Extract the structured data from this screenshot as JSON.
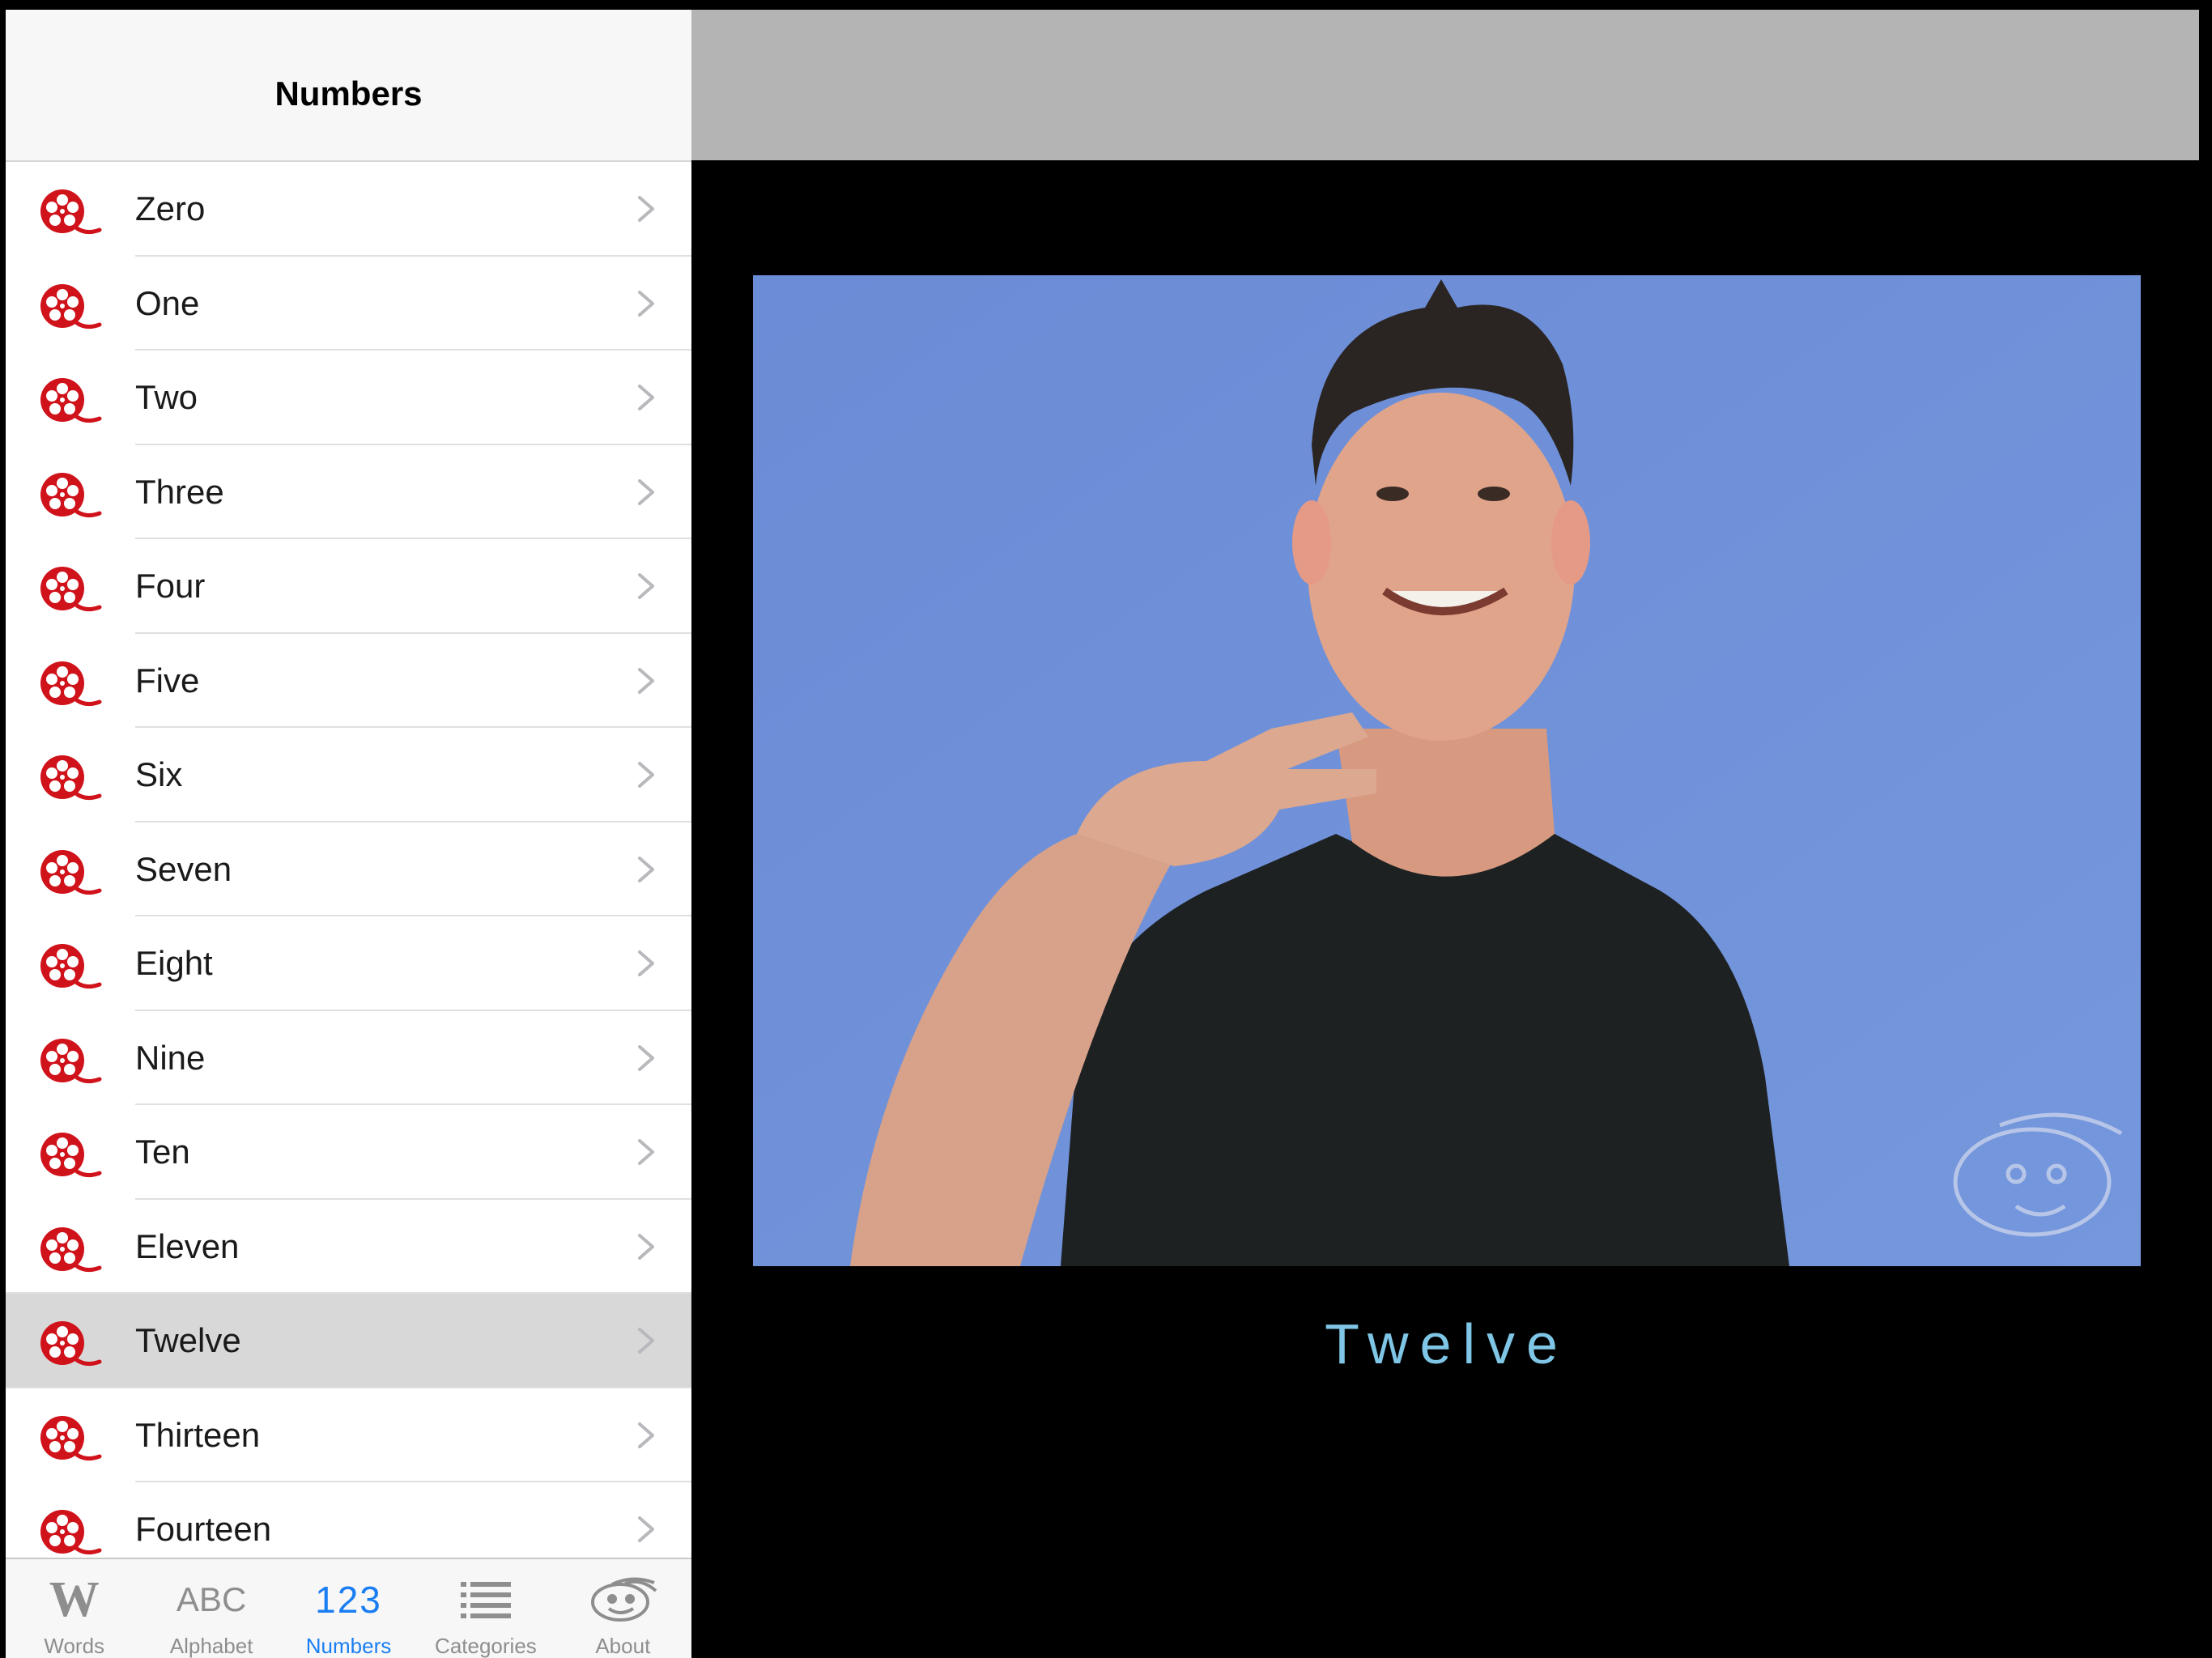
{
  "master": {
    "title": "Numbers",
    "items": [
      {
        "label": "Zero"
      },
      {
        "label": "One"
      },
      {
        "label": "Two"
      },
      {
        "label": "Three"
      },
      {
        "label": "Four"
      },
      {
        "label": "Five"
      },
      {
        "label": "Six"
      },
      {
        "label": "Seven"
      },
      {
        "label": "Eight"
      },
      {
        "label": "Nine"
      },
      {
        "label": "Ten"
      },
      {
        "label": "Eleven"
      },
      {
        "label": "Twelve"
      },
      {
        "label": "Thirteen"
      },
      {
        "label": "Fourteen"
      }
    ],
    "selected": "Twelve",
    "row_icon": "film-reel-icon",
    "accent_color": "#d0121b"
  },
  "tabbar": {
    "tabs": [
      {
        "label": "Words",
        "glyph": "W",
        "icon": "words-icon"
      },
      {
        "label": "Alphabet",
        "glyph": "ABC",
        "icon": "alphabet-icon"
      },
      {
        "label": "Numbers",
        "glyph": "123",
        "icon": "numbers-icon",
        "active": true
      },
      {
        "label": "Categories",
        "icon": "list-icon"
      },
      {
        "label": "About",
        "icon": "mascot-icon"
      }
    ],
    "active_color": "#1a7ef2"
  },
  "detail": {
    "video_description": "sign-language-video",
    "caption": "Twelve"
  }
}
